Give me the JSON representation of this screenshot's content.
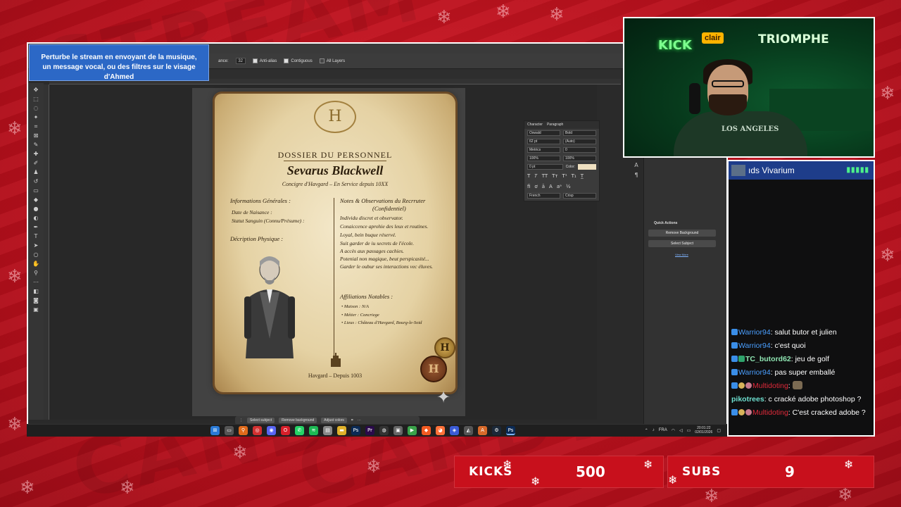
{
  "overlay": {
    "banner_line1": "Perturbe le stream en envoyant de la musique,",
    "banner_line2": "un message vocal, ou des filtres sur le visage d'Ahmed"
  },
  "photoshop": {
    "options": {
      "tolerance_label": "ance:",
      "tolerance_value": "32",
      "anti_alias": "Anti-alias",
      "contiguous": "Contiguous",
      "all_layers": "All Layers"
    },
    "character_panel": {
      "tab_character": "Character",
      "tab_paragraph": "Paragraph",
      "font_family": "Oswald",
      "font_style": "Bold",
      "font_size": "62 pt",
      "leading": "(Auto)",
      "kerning": "Metrics",
      "tracking": "0",
      "scale_v": "100%",
      "scale_h": "100%",
      "baseline": "0 pt",
      "color_label": "Color:",
      "language": "French",
      "antialias": "Crisp",
      "color_swatch": "#efe0c0"
    },
    "quick_actions": {
      "title": "Quick Actions",
      "remove_bg": "Remove Background",
      "select_subject": "Select Subject",
      "view_more": "View More"
    },
    "context_bar": {
      "select_subject": "Select subject",
      "remove_background": "Remove background",
      "adjust_colors": "Adjust colors"
    }
  },
  "document": {
    "crest_letter": "H",
    "title": "DOSSIER DU PERSONNEL",
    "name": "Sevarus Blackwell",
    "subtitle": "Concigre d'Havgard – En Service depuis 10XX",
    "general_header": "Informations Générales :",
    "general_lines": [
      "Date de Naisance :",
      "Statut Sanguin (Connu/Présume) :"
    ],
    "physical_header": "Décription Physique :",
    "notes_header_1": "Notes & Observations du Recrruter",
    "notes_header_2": "(Confidentiel)",
    "notes_lines": [
      "Individu discret et observator.",
      "Conaiccence aprohie des leux et routines.",
      "Loyal, bein buque réservé.",
      "Suit garder de iu secrets de l'école.",
      "A accès aux passages cachies.",
      "Potenial non magique, beut perspicasité...",
      "Garder le oubur ses interactions vec éluves."
    ],
    "affiliations_header": "Affiliations Notables :",
    "affiliations": [
      "• Maison : N/A",
      "• Métier : Concriege",
      "• Lieus : Château d'Havgard, Bourg-le-Soid"
    ],
    "footer": "Havgard – Depuis 1003",
    "seal_letter": "H"
  },
  "taskbar": {
    "language": "FRA",
    "time": "20:01:22",
    "date": "02/01/2026",
    "icons": [
      "windows-icon",
      "explorer-icon",
      "search-icon",
      "discord-icon",
      "opera-icon",
      "whatsapp-icon",
      "spotify-icon",
      "files-icon",
      "folder-icon",
      "photoshop-icon",
      "premiere-icon",
      "obs-icon",
      "app-icon",
      "play-icon",
      "brave-icon",
      "firefox-icon",
      "browser-icon",
      "photos-icon",
      "aseprite-icon",
      "steam-icon",
      "photoshop-active-icon"
    ]
  },
  "webcam": {
    "sign_kick": "KICK",
    "sign_clair": "clair",
    "sign_triomphe": "TRIOMPHE",
    "shirt_text": "LOS ANGELES"
  },
  "chat": {
    "header_title": "ıds Vivarium",
    "messages": [
      {
        "user": "Warrior94",
        "text": ": salut butor et julien"
      },
      {
        "user": "Warrior94",
        "text": ": c'est quoi"
      },
      {
        "user": "TC_butord62",
        "text": ": jeu de golf"
      },
      {
        "user": "Warrior94",
        "text": ": pas super emballé"
      },
      {
        "user": "Multidoting",
        "text": ":"
      },
      {
        "user": "pikotrees",
        "text": ": c cracké adobe photoshop ?"
      },
      {
        "user": "Multidoting",
        "text": ": C'est cracked adobe ?"
      }
    ]
  },
  "counters": {
    "kicks_label": "KICKS",
    "kicks_value": "500",
    "subs_label": "SUBS",
    "subs_value": "9"
  }
}
